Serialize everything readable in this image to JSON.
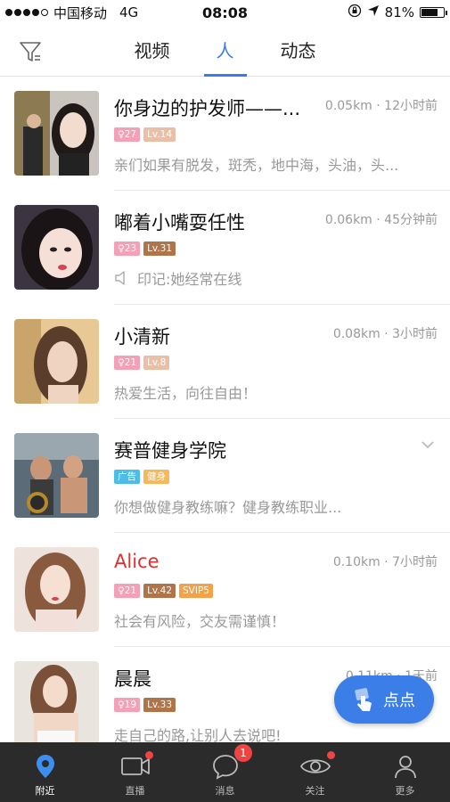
{
  "status": {
    "carrier": "中国移动",
    "network": "4G",
    "time": "08:08",
    "battery": "81%",
    "battery_level": 0.81
  },
  "tabs": [
    {
      "label": "视频",
      "active": false
    },
    {
      "label": "人",
      "active": true
    },
    {
      "label": "动态",
      "active": false
    }
  ],
  "rows": [
    {
      "name": "你身边的护发师——...",
      "meta": "0.05km · 12小时前",
      "gender_age": "♀27",
      "level": "Lv.14",
      "sub": "亲们如果有脱发，斑秃，地中海，头油，头..."
    },
    {
      "name": "嘟着小嘴耍任性",
      "meta": "0.06km · 45分钟前",
      "gender_age": "♀23",
      "level": "Lv.31",
      "sub": "印记:她经常在线"
    },
    {
      "name": "小清新",
      "meta": "0.08km · 3小时前",
      "gender_age": "♀21",
      "level": "Lv.8",
      "sub": "热爱生活，向往自由！"
    },
    {
      "name": "赛普健身学院",
      "meta": "",
      "ad": "广告",
      "category": "健身",
      "sub": "你想做健身教练嘛？健身教练职业..."
    },
    {
      "name": "Alice",
      "meta": "0.10km · 7小时前",
      "gender_age": "♀21",
      "level": "Lv.42",
      "vip": "SVIP5",
      "sub": "社会有风险，交友需谨慎！"
    },
    {
      "name": "晨晨",
      "meta": "0.11km · 1天前",
      "gender_age": "♀19",
      "level": "Lv.33",
      "sub": "走自己的路,让别人去说吧!"
    }
  ],
  "float_button": {
    "label": "点点"
  },
  "tabbar": [
    {
      "label": "附近",
      "icon": "location-pin-icon",
      "active": true
    },
    {
      "label": "直播",
      "icon": "video-camera-icon"
    },
    {
      "label": "消息",
      "icon": "chat-bubble-icon",
      "badge": "1"
    },
    {
      "label": "关注",
      "icon": "eye-icon"
    },
    {
      "label": "更多",
      "icon": "person-icon"
    }
  ],
  "colors": {
    "accent": "#3a7be8",
    "name_highlight": "#e0302f",
    "tabbar_bg": "#2b2b2b"
  }
}
